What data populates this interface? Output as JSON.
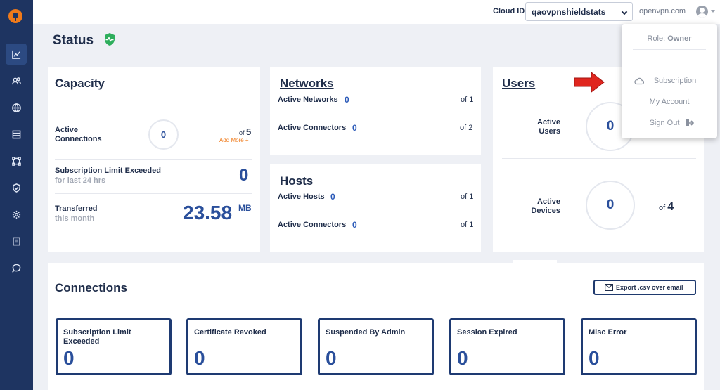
{
  "topbar": {
    "cloud_label": "Cloud ID:",
    "cloud_id": "qaovpnshieldstats",
    "domain": ".openvpn.com"
  },
  "page": {
    "title": "Status"
  },
  "capacity": {
    "title": "Capacity",
    "active_connections_label": "Active Connections",
    "active_connections_value": "0",
    "of_label": "of",
    "of_value": "5",
    "add_more": "Add More +",
    "limit_label": "Subscription Limit Exceeded",
    "limit_sub": "for last 24 hrs",
    "limit_value": "0",
    "transferred_label": "Transferred",
    "transferred_sub": "this month",
    "transferred_value": "23.58",
    "transferred_unit": "MB"
  },
  "networks": {
    "title": "Networks",
    "rows": [
      {
        "label": "Active Networks",
        "value": "0",
        "of": "of 1"
      },
      {
        "label": "Active Connectors",
        "value": "0",
        "of": "of 2"
      }
    ]
  },
  "hosts": {
    "title": "Hosts",
    "rows": [
      {
        "label": "Active Hosts",
        "value": "0",
        "of": "of 1"
      },
      {
        "label": "Active Connectors",
        "value": "0",
        "of": "of 1"
      }
    ]
  },
  "users": {
    "title": "Users",
    "active_users_label": "Active Users",
    "active_users_value": "0",
    "active_devices_label": "Active Devices",
    "active_devices_value": "0",
    "devices_of_label": "of",
    "devices_of_value": "4"
  },
  "dropdown": {
    "role_prefix": "Role:",
    "role_value": "Owner",
    "subscription": "Subscription",
    "my_account": "My Account",
    "sign_out": "Sign Out"
  },
  "connections": {
    "title": "Connections",
    "export_label": "Export .csv over email",
    "boxes": [
      {
        "label": "Subscription Limit Exceeded",
        "value": "0"
      },
      {
        "label": "Certificate Revoked",
        "value": "0"
      },
      {
        "label": "Suspended By Admin",
        "value": "0"
      },
      {
        "label": "Session Expired",
        "value": "0"
      },
      {
        "label": "Misc Error",
        "value": "0"
      }
    ]
  },
  "colors": {
    "sidebar": "#1e3461",
    "accent": "#2a4f9b",
    "brand_orange": "#f07a1a",
    "arrow_red": "#e0261f",
    "shield_green": "#2eae5c"
  },
  "sidebar": {
    "icons": [
      "chart-icon",
      "users-icon",
      "globe-icon",
      "list-icon",
      "network-icon",
      "shield-check-icon",
      "settings-icon",
      "document-icon",
      "chat-icon"
    ]
  }
}
